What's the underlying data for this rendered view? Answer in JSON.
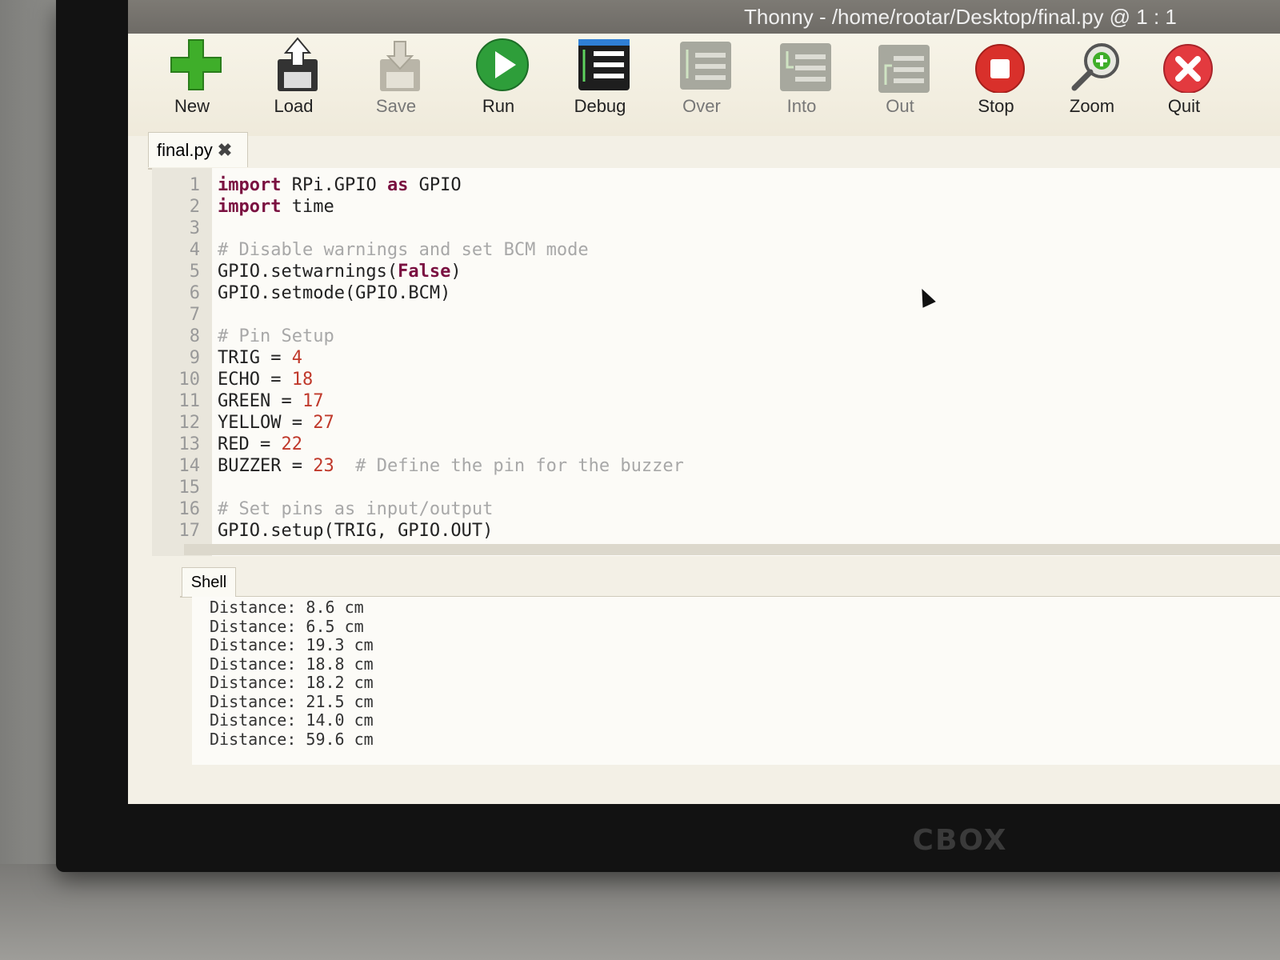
{
  "window": {
    "title": "Thonny  -  /home/rootar/Desktop/final.py  @  1 : 1"
  },
  "monitor": {
    "brand": "CBOX"
  },
  "toolbar": {
    "buttons": [
      {
        "label": "New",
        "icon": "new-icon"
      },
      {
        "label": "Load",
        "icon": "load-icon"
      },
      {
        "label": "Save",
        "icon": "save-icon"
      },
      {
        "label": "Run",
        "icon": "run-icon"
      },
      {
        "label": "Debug",
        "icon": "debug-icon"
      },
      {
        "label": "Over",
        "icon": "step-over-icon"
      },
      {
        "label": "Into",
        "icon": "step-into-icon"
      },
      {
        "label": "Out",
        "icon": "step-out-icon"
      },
      {
        "label": "Stop",
        "icon": "stop-icon"
      },
      {
        "label": "Zoom",
        "icon": "zoom-icon"
      },
      {
        "label": "Quit",
        "icon": "quit-icon"
      }
    ]
  },
  "editor": {
    "tab_label": "final.py",
    "tab_close": "✖",
    "lines": [
      {
        "n": "1",
        "parts": [
          [
            "kw",
            "import"
          ],
          [
            "",
            " RPi.GPIO "
          ],
          [
            "kw",
            "as"
          ],
          [
            "",
            " GPIO"
          ]
        ]
      },
      {
        "n": "2",
        "parts": [
          [
            "kw",
            "import"
          ],
          [
            "",
            " time"
          ]
        ]
      },
      {
        "n": "3",
        "parts": []
      },
      {
        "n": "4",
        "parts": [
          [
            "cmt",
            "# Disable warnings and set BCM mode"
          ]
        ]
      },
      {
        "n": "5",
        "parts": [
          [
            "",
            "GPIO.setwarnings("
          ],
          [
            "kw",
            "False"
          ],
          [
            "",
            ")"
          ]
        ]
      },
      {
        "n": "6",
        "parts": [
          [
            "",
            "GPIO.setmode(GPIO.BCM)"
          ]
        ]
      },
      {
        "n": "7",
        "parts": []
      },
      {
        "n": "8",
        "parts": [
          [
            "cmt",
            "# Pin Setup"
          ]
        ]
      },
      {
        "n": "9",
        "parts": [
          [
            "",
            "TRIG = "
          ],
          [
            "num",
            "4"
          ]
        ]
      },
      {
        "n": "10",
        "parts": [
          [
            "",
            "ECHO = "
          ],
          [
            "num",
            "18"
          ]
        ]
      },
      {
        "n": "11",
        "parts": [
          [
            "",
            "GREEN = "
          ],
          [
            "num",
            "17"
          ]
        ]
      },
      {
        "n": "12",
        "parts": [
          [
            "",
            "YELLOW = "
          ],
          [
            "num",
            "27"
          ]
        ]
      },
      {
        "n": "13",
        "parts": [
          [
            "",
            "RED = "
          ],
          [
            "num",
            "22"
          ]
        ]
      },
      {
        "n": "14",
        "parts": [
          [
            "",
            "BUZZER = "
          ],
          [
            "num",
            "23"
          ],
          [
            "cmt",
            "  # Define the pin for the buzzer"
          ]
        ]
      },
      {
        "n": "15",
        "parts": []
      },
      {
        "n": "16",
        "parts": [
          [
            "cmt",
            "# Set pins as input/output"
          ]
        ]
      },
      {
        "n": "17",
        "parts": [
          [
            "",
            "GPIO.setup(TRIG, GPIO.OUT)"
          ]
        ]
      }
    ]
  },
  "shell": {
    "tab_label": "Shell",
    "output": [
      "Distance: 8.6 cm",
      "Distance: 6.5 cm",
      "Distance: 19.3 cm",
      "Distance: 18.8 cm",
      "Distance: 18.2 cm",
      "Distance: 21.5 cm",
      "Distance: 14.0 cm",
      "Distance: 59.6 cm"
    ]
  }
}
